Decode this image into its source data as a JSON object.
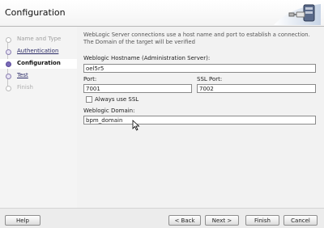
{
  "window": {
    "title": "Configuration"
  },
  "steps": [
    {
      "label": "Name and Type",
      "state": "done"
    },
    {
      "label": "Authentication",
      "state": "link"
    },
    {
      "label": "Configuration",
      "state": "active"
    },
    {
      "label": "Test",
      "state": "link"
    },
    {
      "label": "Finish",
      "state": "disabled"
    }
  ],
  "form": {
    "description": "WebLogic Server connections use a host name and port to establish a connection. The Domain of the target will be verified",
    "hostname_label": "Weblogic Hostname (Administration Server):",
    "hostname_value": "oel5r5",
    "port_label": "Port:",
    "port_value": "7001",
    "ssl_port_label": "SSL Port:",
    "ssl_port_value": "7002",
    "always_ssl_label": "Always use SSL",
    "always_ssl_checked": false,
    "domain_label": "Weblogic Domain:",
    "domain_value": "bpm_domain"
  },
  "footer": {
    "help": "Help",
    "back": "< Back",
    "next": "Next >",
    "finish": "Finish",
    "cancel": "Cancel"
  }
}
